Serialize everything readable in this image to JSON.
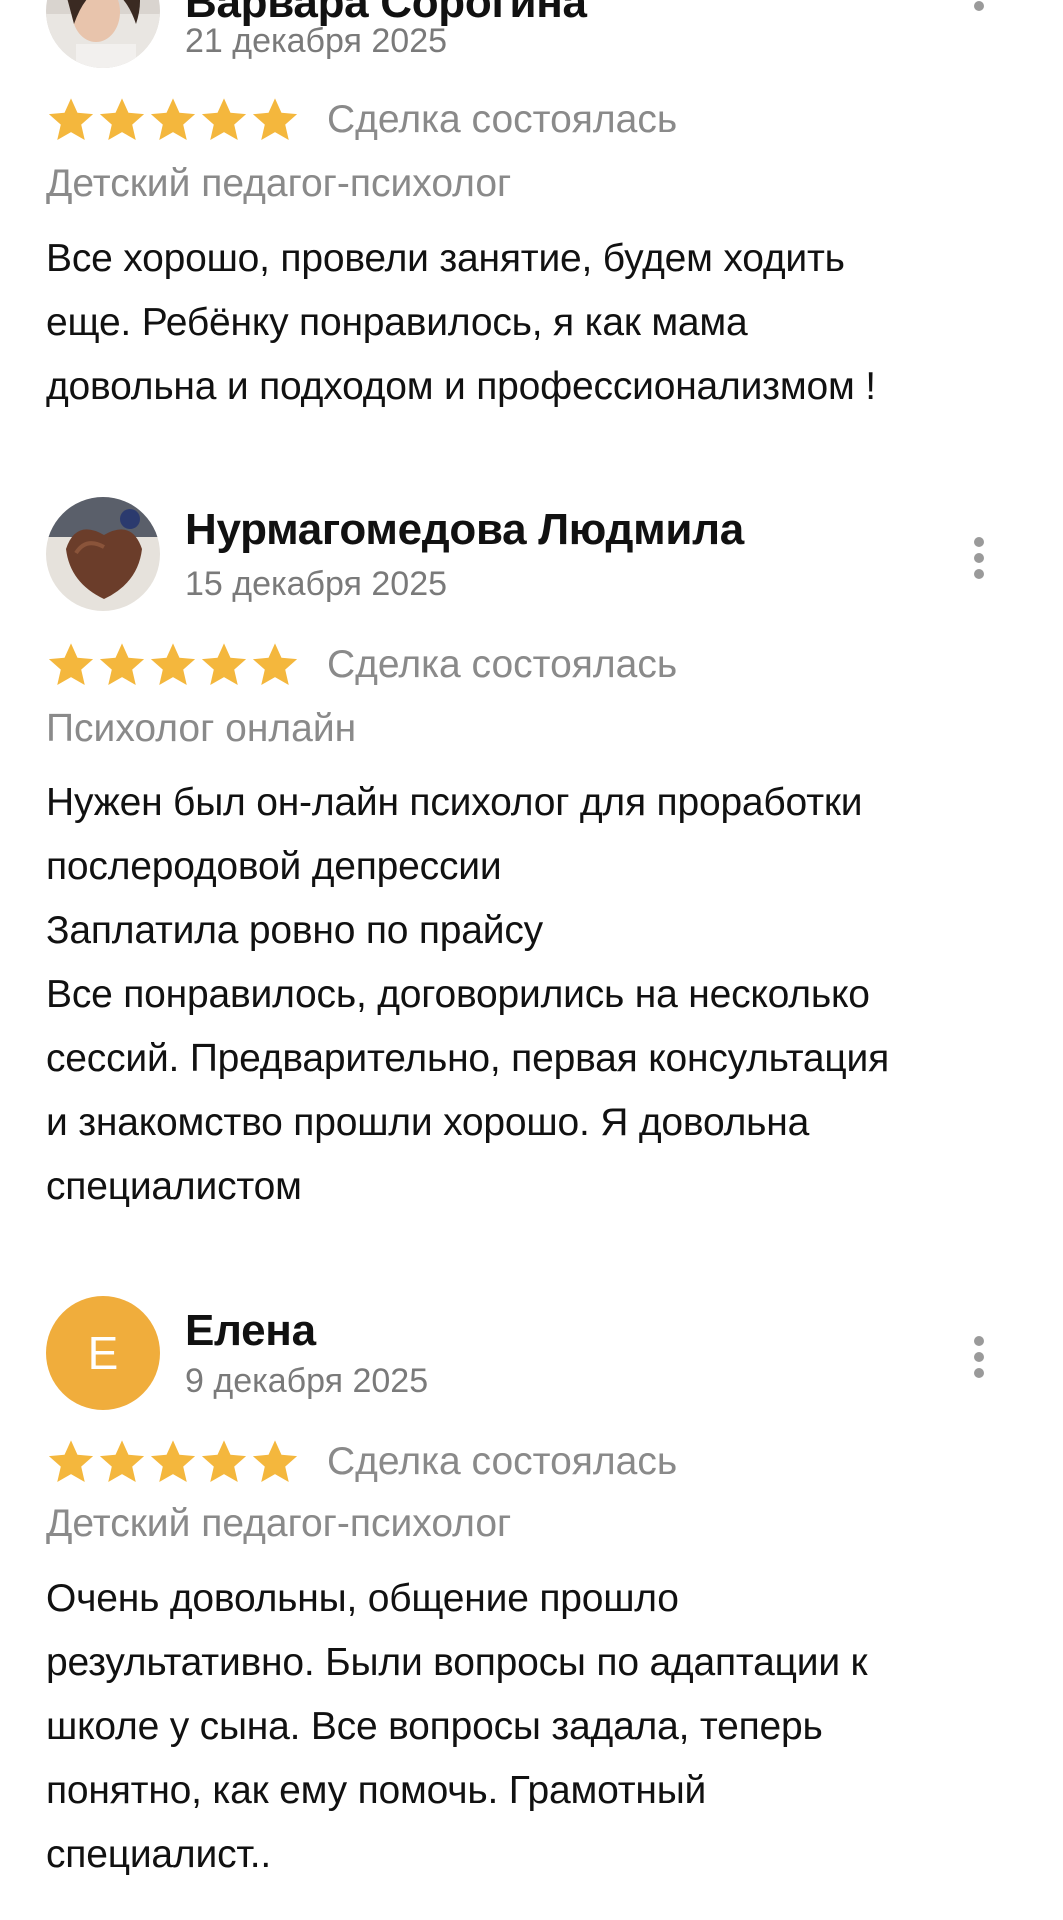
{
  "colors": {
    "star": "#f4b73d",
    "avatar_letter_bg": "#f0ad3c",
    "muted_text": "#8a8a8a"
  },
  "icons": {
    "star": "star-icon",
    "more": "more-vertical-icon"
  },
  "reviews": [
    {
      "author": "Варвара Сорогина",
      "date": "21 декабря 2025",
      "rating": 5,
      "rating_max": 5,
      "deal_status": "Сделка состоялась",
      "service": "Детский педагог-психолог",
      "text_lines": [
        "Все хорошо, провели занятие, будем ходить",
        "еще. Ребёнку понравилось, я как мама",
        "довольна и подходом и профессионализмом !"
      ]
    },
    {
      "author": "Нурмагомедова Людмила",
      "date": "15 декабря 2025",
      "rating": 5,
      "rating_max": 5,
      "deal_status": "Сделка состоялась",
      "service": "Психолог онлайн",
      "text_lines": [
        "Нужен был он-лайн психолог для проработки",
        "послеродовой депрессии",
        "Заплатила ровно по прайсу",
        "Все понравилось, договорились на несколько",
        "сессий. Предварительно, первая консультация",
        "и знакомство прошли хорошо. Я довольна",
        "специалистом"
      ]
    },
    {
      "author": "Елена",
      "avatar_letter": "Е",
      "date": "9 декабря 2025",
      "rating": 5,
      "rating_max": 5,
      "deal_status": "Сделка состоялась",
      "service": "Детский педагог-психолог",
      "text_lines": [
        "Очень довольны, общение прошло",
        "результативно. Были вопросы по адаптации к",
        "школе у сына. Все вопросы задала, теперь",
        "понятно, как  ему помочь. Грамотный",
        "специалист.."
      ]
    }
  ]
}
